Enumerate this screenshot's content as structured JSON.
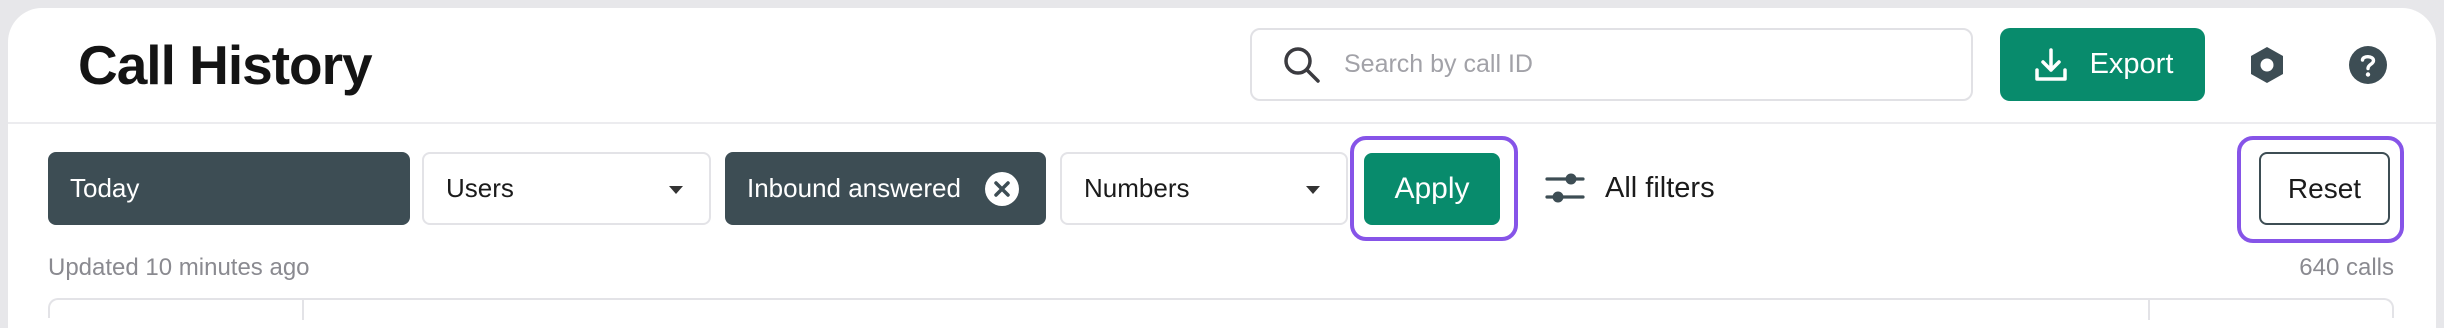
{
  "header": {
    "title": "Call History",
    "search": {
      "placeholder": "Search by call ID",
      "value": "",
      "icon": "search-icon"
    },
    "export_label": "Export",
    "icons": {
      "settings": "hexagon-settings-icon",
      "help": "help-icon"
    }
  },
  "filters": {
    "date": {
      "label": "Today"
    },
    "users": {
      "label": "Users"
    },
    "call_type": {
      "label": "Inbound answered"
    },
    "numbers": {
      "label": "Numbers"
    },
    "apply_label": "Apply",
    "all_filters_label": "All filters",
    "reset_label": "Reset"
  },
  "status": {
    "updated": "Updated 10 minutes ago",
    "count": "640 calls"
  },
  "colors": {
    "primary": "#088b6c",
    "chip_active": "#3d4d54",
    "highlight": "#8654e8"
  }
}
